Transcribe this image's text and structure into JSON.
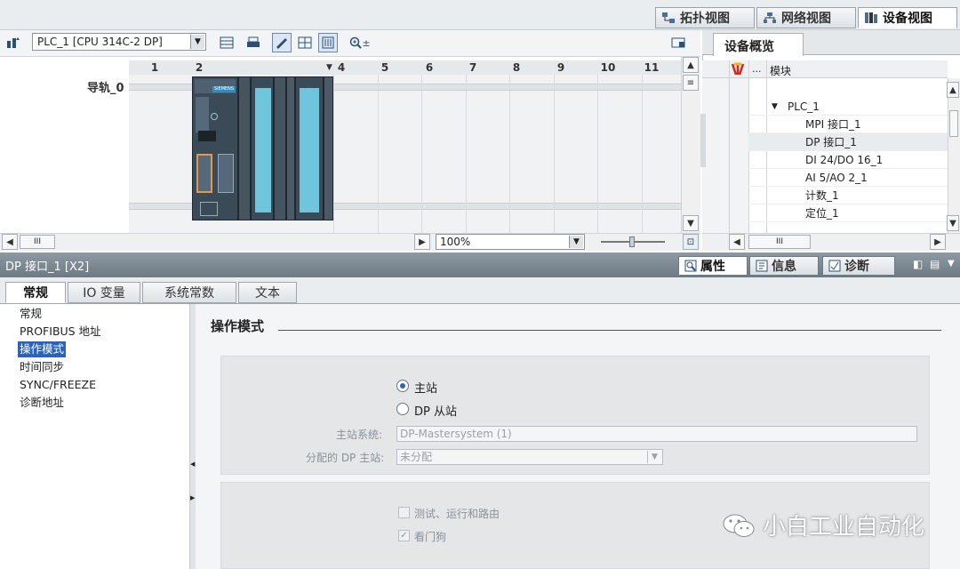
{
  "view_tabs": [
    {
      "label": "拓扑视图"
    },
    {
      "label": "网络视图"
    },
    {
      "label": "设备视图"
    }
  ],
  "toolbar": {
    "plc_select": "PLC_1 [CPU 314C-2 DP]",
    "zoom_in_label": "±"
  },
  "canvas": {
    "slot_numbers": [
      "1",
      "2",
      "4",
      "5",
      "6",
      "7",
      "8",
      "9",
      "10",
      "11"
    ],
    "rail_label": "导轨_0",
    "module_brand": "SIEMENS"
  },
  "zoom": {
    "value": "100%"
  },
  "overview": {
    "tab_label": "设备概览",
    "col_dots": "...",
    "col_module": "模块",
    "rows": [
      {
        "label": "PLC_1",
        "indent": 0,
        "expanded": true,
        "selected": false
      },
      {
        "label": "MPI 接口_1",
        "indent": 1,
        "selected": false
      },
      {
        "label": "DP 接口_1",
        "indent": 1,
        "selected": true
      },
      {
        "label": "DI 24/DO 16_1",
        "indent": 1,
        "selected": false
      },
      {
        "label": "AI 5/AO 2_1",
        "indent": 1,
        "selected": false
      },
      {
        "label": "计数_1",
        "indent": 1,
        "selected": false
      },
      {
        "label": "定位_1",
        "indent": 1,
        "selected": false
      }
    ]
  },
  "inspector": {
    "title": "DP 接口_1 [X2]",
    "tabs": [
      {
        "label": "属性",
        "active": true
      },
      {
        "label": "信息",
        "active": false
      },
      {
        "label": "诊断",
        "active": false
      }
    ],
    "subtabs": [
      {
        "label": "常规",
        "active": true
      },
      {
        "label": "IO 变量",
        "active": false
      },
      {
        "label": "系统常数",
        "active": false
      },
      {
        "label": "文本",
        "active": false
      }
    ],
    "nav": [
      {
        "label": "常规",
        "selected": false
      },
      {
        "label": "PROFIBUS 地址",
        "selected": false
      },
      {
        "label": "操作模式",
        "selected": true
      },
      {
        "label": "时间同步",
        "selected": false
      },
      {
        "label": "SYNC/FREEZE",
        "selected": false
      },
      {
        "label": "诊断地址",
        "selected": false
      }
    ],
    "section_title": "操作模式",
    "mode_master": "主站",
    "mode_dp_slave": "DP 从站",
    "master_system_label": "主站系统:",
    "master_system_value": "DP-Mastersystem (1)",
    "assigned_master_label": "分配的 DP 主站:",
    "assigned_master_value": "未分配",
    "chk_test": "测试、运行和路由",
    "chk_watchdog": "看门狗"
  },
  "watermark": "小白工业自动化",
  "colors": {
    "accent": "#2a63b8",
    "io_strip": "#6fc6dc",
    "module_body": "#3b4a57",
    "inspector_bar": "#7d8993"
  }
}
